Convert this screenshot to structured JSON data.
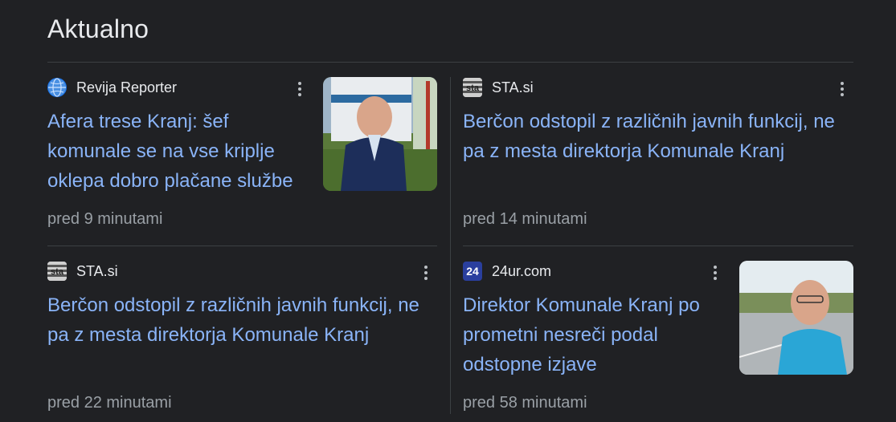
{
  "section": {
    "title": "Aktualno"
  },
  "articles": [
    {
      "source": "Revija Reporter",
      "source_icon": "globe-logo",
      "headline": "Afera trese Kranj: šef komunale se na vse kriplje oklepa dobro plačane službe",
      "time": "pred 9 minutami",
      "has_thumbnail": true
    },
    {
      "source": "STA.si",
      "source_icon": "sta-logo",
      "headline": "Berčon odstopil z različnih javnih funkcij, ne pa z mesta direktorja Komunale Kranj",
      "time": "pred 14 minutami",
      "has_thumbnail": false
    },
    {
      "source": "STA.si",
      "source_icon": "sta-logo",
      "headline": "Berčon odstopil z različnih javnih funkcij, ne pa z mesta direktorja Komunale Kranj",
      "time": "pred 22 minutami",
      "has_thumbnail": false
    },
    {
      "source": "24ur.com",
      "source_icon": "24ur-logo",
      "source_logo_text": "24",
      "headline": "Direktor Komunale Kranj po prometni nesreči podal odstopne izjave",
      "time": "pred 58 minutami",
      "has_thumbnail": true
    }
  ],
  "colors": {
    "background": "#202124",
    "headline": "#8ab4f8",
    "meta": "#9aa0a6",
    "title": "#e8eaed"
  }
}
